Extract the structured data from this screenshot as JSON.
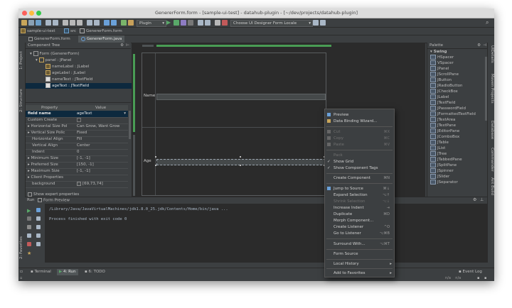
{
  "window": {
    "title": "GenererForm.form - [sample-ui-test] - datahub-plugin - [~/dev/projects/datahub-plugin]"
  },
  "toolbar": {
    "plugin_combo": "Plugin",
    "form_locale_combo": "Choose UI Designer Form Locale"
  },
  "navbar": {
    "crumbs": [
      "sample-ui-test",
      "src",
      "GenererForm.form"
    ]
  },
  "editor_tabs": [
    {
      "label": "GenererForm.form"
    },
    {
      "label": "GenererForm.java"
    }
  ],
  "left_strip": {
    "labels": [
      "1: Project",
      "2: Structure",
      "2: Favorites"
    ]
  },
  "right_strip": {
    "labels": [
      "UIDetails",
      "Maven Projects",
      "Database",
      "Commander",
      "Ant Build"
    ]
  },
  "component_tree": {
    "header": "Component Tree",
    "rows": [
      {
        "label": "Form (GenererForm)"
      },
      {
        "label": "panel : JPanel"
      },
      {
        "label": "nameLabel : JLabel"
      },
      {
        "label": "ageLabel : JLabel"
      },
      {
        "label": "nameText : JTextField"
      },
      {
        "label": "ageText : JTextField"
      }
    ]
  },
  "properties": {
    "col_property": "Property",
    "col_value": "Value",
    "rows": [
      {
        "name": "field name",
        "value": "ageText"
      },
      {
        "name": "Custom Create",
        "value": ""
      },
      {
        "name": "Horizontal Size Pol",
        "value": "Can Grow, Want Grow"
      },
      {
        "name": "Vertical Size Polic",
        "value": "Fixed"
      },
      {
        "name": "Horizontal Align",
        "value": "Fill"
      },
      {
        "name": "Vertical Align",
        "value": "Center"
      },
      {
        "name": "Indent",
        "value": "0"
      },
      {
        "name": "Minimum Size",
        "value": "[-1, -1]"
      },
      {
        "name": "Preferred Size",
        "value": "[150, -1]"
      },
      {
        "name": "Maximum Size",
        "value": "[-1, -1]"
      },
      {
        "name": "Client Properties",
        "value": ""
      },
      {
        "name": "background",
        "value": "[69,73,74]"
      }
    ],
    "show_expert": "Show expert properties"
  },
  "designer": {
    "name_label": "Name",
    "age_label": "Age"
  },
  "palette": {
    "header": "Palette",
    "group": "Swing",
    "items": [
      "HSpacer",
      "VSpacer",
      "JPanel",
      "JScrollPane",
      "JButton",
      "JRadioButton",
      "JCheckBox",
      "JLabel",
      "JTextField",
      "JPasswordField",
      "JFormattedTextField",
      "JTextArea",
      "JTextPane",
      "JEditorPane",
      "JComboBox",
      "JTable",
      "JList",
      "JTree",
      "JTabbedPane",
      "JSplitPane",
      "JSpinner",
      "JSlider",
      "JSeparator"
    ]
  },
  "run": {
    "header_label": "Run",
    "config": "Form Preview",
    "command": "/Library/Java/JavaVirtualMachines/jdk1.8.0_25.jdk/Contents/Home/bin/java ...",
    "output": "Process finished with exit code 0"
  },
  "bottom_tabs": [
    {
      "label": "Terminal"
    },
    {
      "label": "4: Run"
    },
    {
      "label": "6: TODO"
    }
  ],
  "event_log": "Event Log",
  "status": {
    "right": "n/a    n/a"
  },
  "context_menu": {
    "items": [
      {
        "label": "Preview",
        "shortcut": "",
        "enabled": true
      },
      {
        "label": "Data Binding Wizard...",
        "shortcut": "",
        "enabled": true
      },
      {
        "label": "Cut",
        "shortcut": "⌘X",
        "enabled": false
      },
      {
        "label": "Copy",
        "shortcut": "⌘C",
        "enabled": false
      },
      {
        "label": "Paste",
        "shortcut": "⌘V",
        "enabled": false
      },
      {
        "label": "Pack",
        "shortcut": "",
        "enabled": false
      },
      {
        "label": "Show Grid",
        "shortcut": "",
        "enabled": true
      },
      {
        "label": "Show Component Tags",
        "shortcut": "",
        "enabled": true
      },
      {
        "label": "Create Component",
        "shortcut": "⌘N",
        "enabled": true
      },
      {
        "label": "Jump to Source",
        "shortcut": "⌘↓",
        "enabled": true
      },
      {
        "label": "Expand Selection",
        "shortcut": "⌥↑",
        "enabled": true
      },
      {
        "label": "Shrink Selection",
        "shortcut": "⌥↓",
        "enabled": false
      },
      {
        "label": "Increase Indent",
        "shortcut": "⇥",
        "enabled": true
      },
      {
        "label": "Duplicate",
        "shortcut": "⌘D",
        "enabled": true
      },
      {
        "label": "Morph Component...",
        "shortcut": "",
        "enabled": true
      },
      {
        "label": "Create Listener",
        "shortcut": "^O",
        "enabled": true
      },
      {
        "label": "Go to Listener",
        "shortcut": "⌥⌘B",
        "enabled": true
      },
      {
        "label": "Surround With...",
        "shortcut": "⌥⌘T",
        "enabled": true
      },
      {
        "label": "Form Source",
        "shortcut": "",
        "enabled": true
      },
      {
        "label": "Local History",
        "shortcut": "",
        "enabled": true
      },
      {
        "label": "Add to Favorites",
        "shortcut": "",
        "enabled": true
      }
    ]
  },
  "colors": {
    "bg": "#3c3f41",
    "editor_bg": "#2b2b2b",
    "selection": "#0d293e",
    "accent_green": "#499c54"
  }
}
